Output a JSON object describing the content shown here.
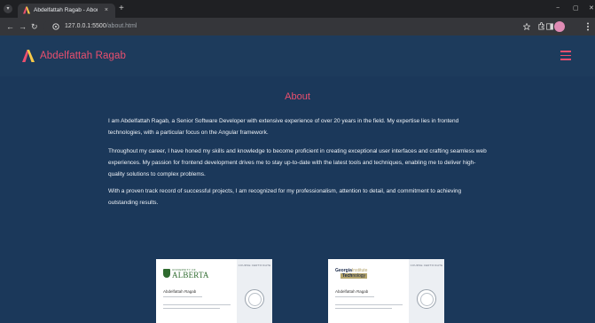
{
  "browser": {
    "tab_title": "Abdelfattah Ragab - About",
    "tab_close": "×",
    "new_tab": "+",
    "win_menu": "▾",
    "window_controls": {
      "minimize": "−",
      "maximize": "▢",
      "close": "✕"
    },
    "nav": {
      "back": "←",
      "forward": "→",
      "reload": "↻"
    },
    "url_host": "127.0.0.1:5500",
    "url_path": "/about.html",
    "icons": {
      "site_info": "site-info-icon",
      "bookmark": "star-icon",
      "extensions": "puzzle-icon",
      "sidepanel": "sidepanel-icon",
      "profile": "avatar",
      "menu": "kebab-menu-icon"
    }
  },
  "header": {
    "brand_name": "Abdelfattah Ragab",
    "accent_color": "#ea4f6e",
    "background_color": "#1d3b5c"
  },
  "main": {
    "title": "About",
    "paragraphs": [
      "I am Abdelfattah Ragab, a Senior Software Developer with extensive experience of over 20 years in the field. My expertise lies in frontend technologies, with a particular focus on the Angular framework.",
      "Throughout my career, I have honed my skills and knowledge to become proficient in creating exceptional user interfaces and crafting seamless web experiences. My passion for frontend development drives me to stay up-to-date with the latest tools and techniques, enabling me to deliver high-quality solutions to complex problems.",
      "With a proven track record of successful projects, I am recognized for my professionalism, attention to detail, and commitment to achieving outstanding results."
    ],
    "certificates": [
      {
        "issuer_top": "UNIVERSITY OF",
        "issuer_name": "ALBERTA",
        "badge_label": "COURSE CERTIFICATE",
        "recipient": "Abdelfattah Ragab"
      },
      {
        "issuer_top": "Georgia",
        "issuer_top_suffix": "Institute",
        "issuer_bottom": "Tech",
        "issuer_bottom_suffix": "nology",
        "badge_label": "COURSE CERTIFICATE",
        "recipient": "Abdelfattah Ragab"
      }
    ]
  }
}
